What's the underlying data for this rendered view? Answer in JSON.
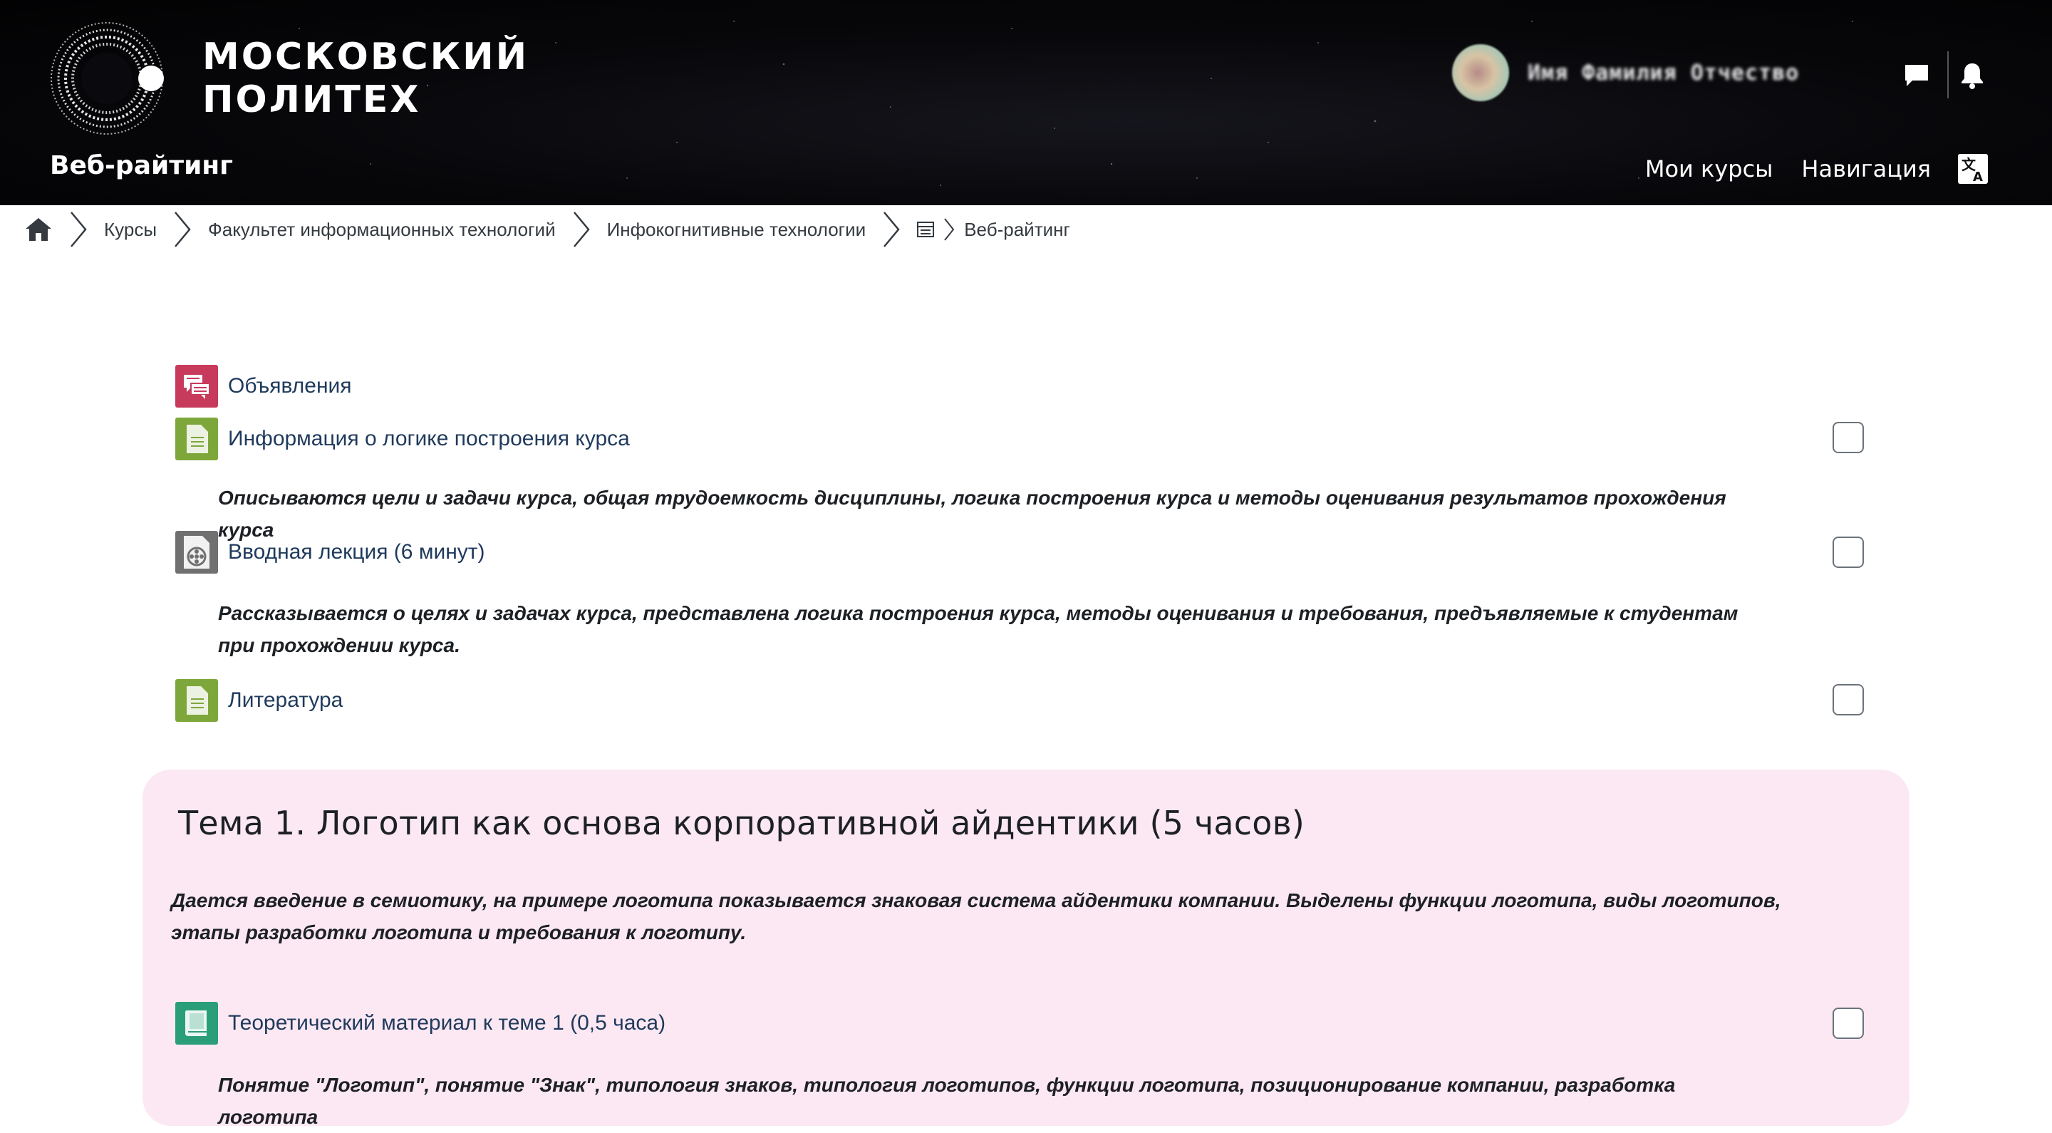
{
  "header": {
    "logo_line1": "МОСКОВСКИЙ",
    "logo_line2": "ПОЛИТЕХ",
    "site_title": "Веб-райтинг",
    "user_name": "Имя Фамилия Отчество",
    "nav": [
      {
        "label": "Мои курсы"
      },
      {
        "label": "Навигация"
      }
    ],
    "icons": [
      "messages-icon",
      "notifications-icon",
      "language-icon"
    ]
  },
  "breadcrumb": {
    "items": [
      {
        "label": "Курсы"
      },
      {
        "label": "Факультет информационных технологий"
      },
      {
        "label": "Инфокогнитивные технологии"
      },
      {
        "label": "Веб-райтинг"
      }
    ]
  },
  "activities": [
    {
      "label": "Объявления",
      "icon": "forum-icon",
      "color": "#c73a5c"
    },
    {
      "label": "Информация о логике построения курса",
      "icon": "page-icon",
      "color": "#7ea73b",
      "description": "Описываются цели и задачи курса, общая трудоемкость дисциплины, логика построения курса и методы оценивания результатов прохождения курса"
    },
    {
      "label": "Вводная лекция (6 минут)",
      "icon": "video-icon",
      "color": "#707070",
      "description": "Рассказывается о целях и задачах курса, представлена логика построения курса, методы оценивания и требования, предъявляемые к студентам при прохождении курса."
    },
    {
      "label": "Литература",
      "icon": "page-icon",
      "color": "#7ea73b"
    }
  ],
  "section": {
    "title": "Тема 1. Логотип как основа корпоративной айдентики (5 часов)",
    "description": "Дается введение в семиотику, на примере логотипа показывается знаковая система айдентики компании. Выделены функции логотипа, виды логотипов, этапы разработки логотипа и требования к логотипу.",
    "activity": {
      "label": "Теоретический материал к теме 1 (0,5 часа)",
      "icon": "book-icon",
      "color": "#2a9e78",
      "description": "Понятие \"Логотип\", понятие \"Знак\", типология знаков, типология логотипов, функции логотипа, позиционирование компании, разработка логотипа"
    }
  }
}
